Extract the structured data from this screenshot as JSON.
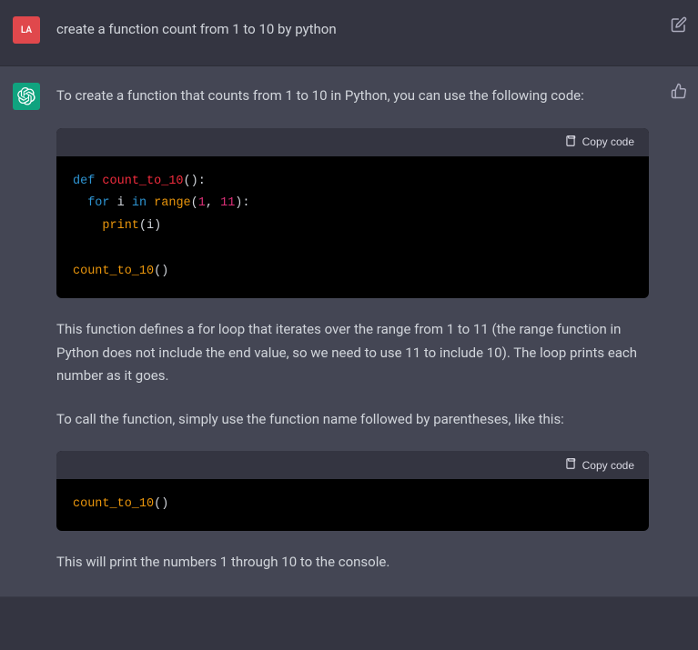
{
  "user": {
    "avatar_label": "LA",
    "message": "create a function count from 1 to 10 by python"
  },
  "assistant": {
    "intro": "To create a function that counts from 1 to 10 in Python, you can use the following code:",
    "explain1": "This function defines a for loop that iterates over the range from 1 to 11 (the range function in Python does not include the end value, so we need to use 11 to include 10). The loop prints each number as it goes.",
    "explain2": "To call the function, simply use the function name followed by parentheses, like this:",
    "explain3": "This will print the numbers 1 through 10 to the console."
  },
  "code": {
    "copy_label": "Copy code",
    "block1": {
      "kw_def": "def",
      "fn_name": "count_to_10",
      "kw_for": "for",
      "var_i": "i",
      "kw_in": "in",
      "fn_range": "range",
      "num_1": "1",
      "num_11": "11",
      "fn_print": "print",
      "arg_i": "i",
      "call_name": "count_to_10"
    },
    "block2": {
      "call_name": "count_to_10"
    }
  }
}
